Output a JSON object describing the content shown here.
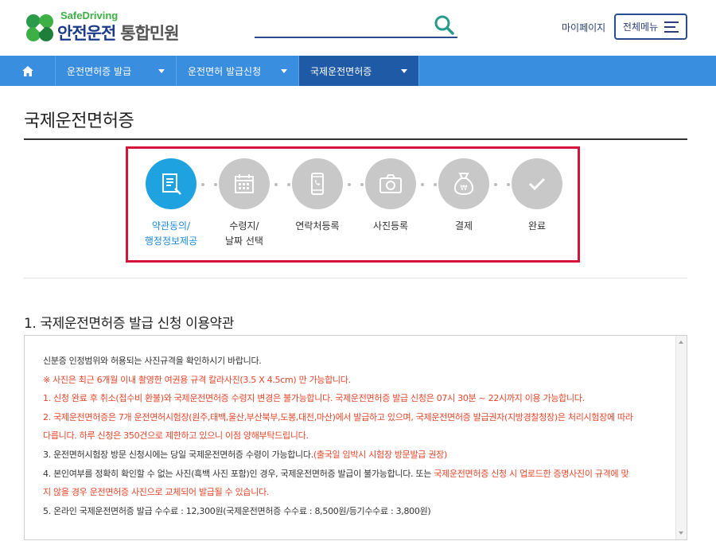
{
  "header": {
    "logo_en": "SafeDriving",
    "logo_main": "안전운전",
    "logo_sub": "통합민원",
    "mypage_label": "마이페이지",
    "allmenu_label": "전체메뉴"
  },
  "nav": {
    "items": [
      {
        "label": "운전면허증 발급"
      },
      {
        "label": "운전면허 발급신청"
      },
      {
        "label": "국제운전면허증"
      }
    ]
  },
  "page": {
    "title": "국제운전면허증"
  },
  "steps": [
    {
      "line1": "약관동의/",
      "line2": "행정정보제공",
      "icon": "document-pen-icon"
    },
    {
      "line1": "수령지/",
      "line2": "날짜 선택",
      "icon": "calendar-icon"
    },
    {
      "line1": "연락처등록",
      "line2": "",
      "icon": "phone-icon"
    },
    {
      "line1": "사진등록",
      "line2": "",
      "icon": "camera-icon"
    },
    {
      "line1": "결제",
      "line2": "",
      "icon": "money-bag-icon"
    },
    {
      "line1": "완료",
      "line2": "",
      "icon": "check-icon"
    }
  ],
  "terms": {
    "heading": "1. 국제운전면허증 발급 신청 이용약관",
    "line_intro": "신분증 인정범위와 허용되는 사진규격을 확인하시기 바랍니다.",
    "line_photo": "※ 사진은 최근 6개월 이내 촬영한 여권용 규격 칼라사진(3.5 X 4.5cm) 만 가능합니다.",
    "line_1": "1. 신청 완료 후 취소(접수비 환불)와 국제운전면허증 수령지 변경은 불가능합니다. 국제운전면허증 발급 신청은 07시 30분 ~ 22시까지 이용 가능합니다.",
    "line_2a": "2. 국제운전면허증은 7개 운전면허시험장(원주,태백,울산,부산북부,도봉,대전,마산)에서 발급하고 있으며, 국제운전면허증 발급권자(지방경찰청장)은 처리시험장에 따라",
    "line_2b": "다릅니다. 하루 신청은 350건으로 제한하고 있으니 이점 양해부탁드립니다.",
    "line_3_black": "3. 운전면허시험장 방문 신청시에는 당일 국제운전면허증 수령이 가능합니다.",
    "line_3_red": "(출국일 임박시 시험장 방문발급 권장)",
    "line_4a_black": "4. 본인여부를 정확히 확인할 수 없는 사진(흑백 사진 포함)인 경우, 국제운전면허증 발급이 불가능합니다. 또는 ",
    "line_4a_red": "국제운전면허증 신청 시 업로드한 증명사진이 규격에 맞",
    "line_4b_red": "지 않을 경우 운전면허증 사진으로 교체되어 발급될 수 있습니다.",
    "line_5": "5. 온라인 국제운전면허증 발급 수수료 : 12,300원(국제운전면허증 수수료 : 8,500원/등기수수료 : 3,800원)"
  },
  "colors": {
    "nav_bg": "#3a8ee0",
    "nav_active": "#1e5aa6",
    "step_active": "#1fa3e0",
    "step_inactive": "#c8c8c8",
    "highlight_border": "#d6133a",
    "notice_red": "#e8452a"
  }
}
